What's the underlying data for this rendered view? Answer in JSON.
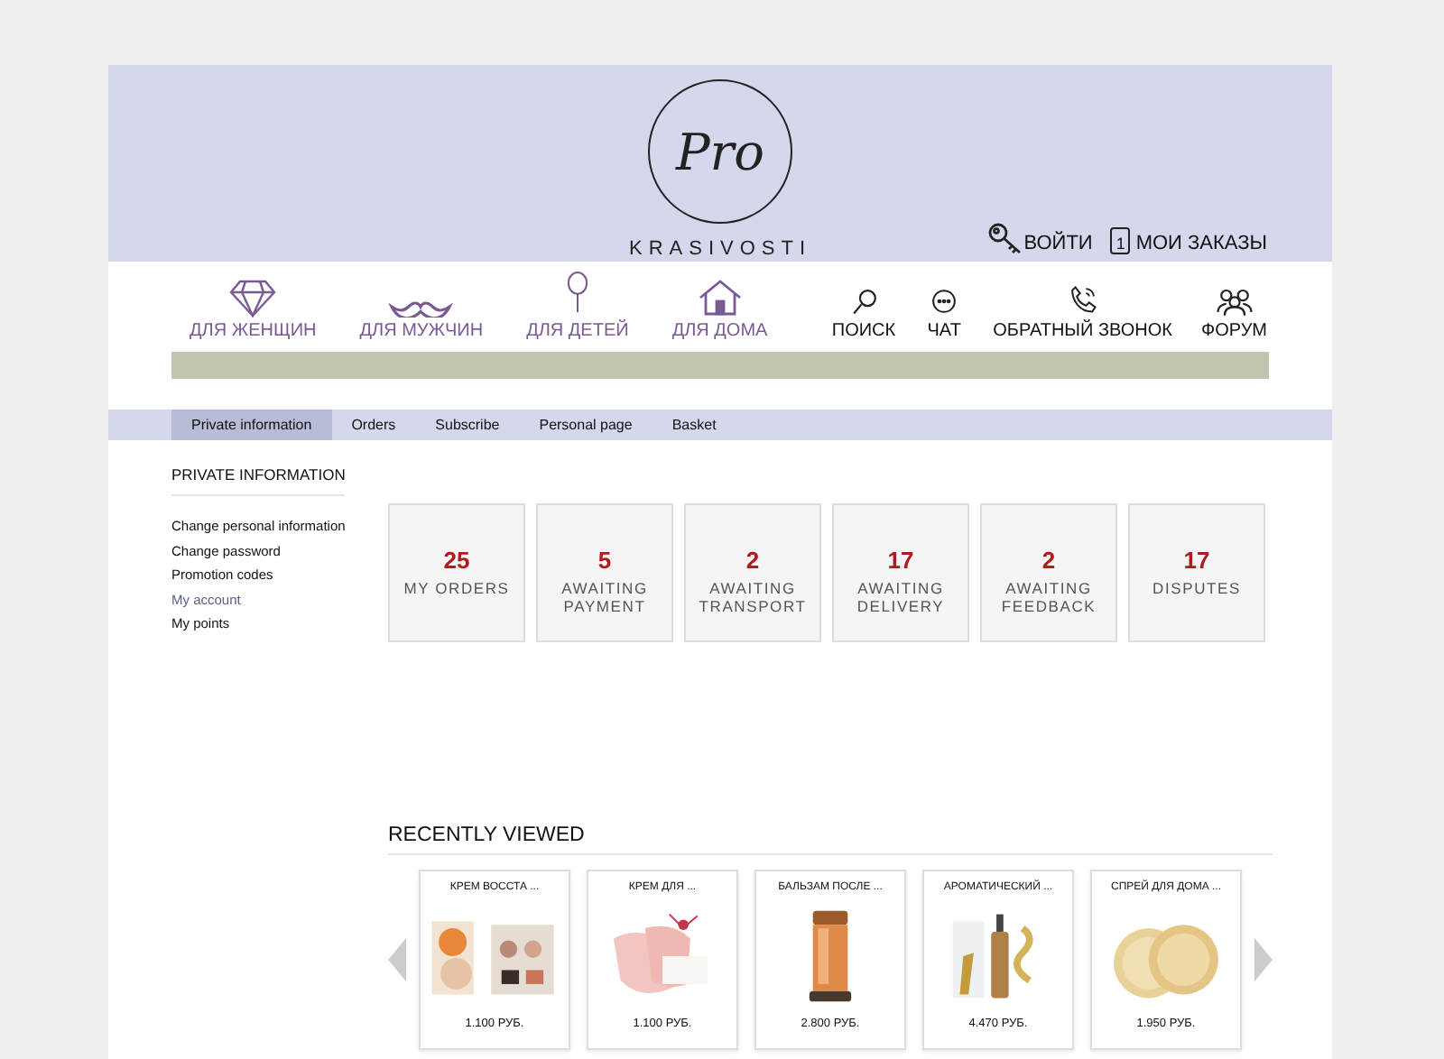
{
  "logo": {
    "mark": "Pro",
    "name": "KRASIVOSTI"
  },
  "account_links": [
    {
      "label": "ВОЙТИ"
    },
    {
      "label": "МОИ ЗАКАЗЫ",
      "badge": "1"
    }
  ],
  "categories": [
    {
      "label": "ДЛЯ ЖЕНЩИН"
    },
    {
      "label": "ДЛЯ МУЖЧИН"
    },
    {
      "label": "ДЛЯ ДЕТЕЙ"
    },
    {
      "label": "ДЛЯ ДОМА"
    }
  ],
  "tools": [
    {
      "label": "ПОИСК"
    },
    {
      "label": "ЧАТ"
    },
    {
      "label": "ОБРАТНЫЙ ЗВОНОК"
    },
    {
      "label": "ФОРУМ"
    }
  ],
  "tabs": [
    {
      "label": "Private information",
      "selected": true
    },
    {
      "label": "Orders",
      "selected": false
    },
    {
      "label": "Subscribe",
      "selected": false
    },
    {
      "label": "Personal page",
      "selected": false
    },
    {
      "label": "Basket",
      "selected": false
    }
  ],
  "sidebar": {
    "title": "PRIVATE INFORMATION",
    "items": [
      {
        "label": "Change personal information",
        "selected": false
      },
      {
        "label": "Change password",
        "selected": false
      },
      {
        "label": "Promotion codes",
        "selected": false
      },
      {
        "label": "My account",
        "selected": true
      },
      {
        "label": "My points",
        "selected": false
      }
    ]
  },
  "stats": [
    {
      "value": "25",
      "label": "MY ORDERS"
    },
    {
      "value": "5",
      "label": "AWAITING PAYMENT"
    },
    {
      "value": "2",
      "label": "AWAITING TRANSPORT"
    },
    {
      "value": "17",
      "label": "AWAITING DELIVERY"
    },
    {
      "value": "2",
      "label": "AWAITING FEEDBACK"
    },
    {
      "value": "17",
      "label": "DISPUTES"
    }
  ],
  "recently_viewed": {
    "title": "RECENTLY VIEWED",
    "products": [
      {
        "name": "КРЕМ ВОССТА ...",
        "price": "1.100 РУБ.",
        "kind": "picture"
      },
      {
        "name": "КРЕМ ДЛЯ ...",
        "price": "1.100 РУБ.",
        "kind": "picture"
      },
      {
        "name": "БАЛЬЗАМ ПОСЛЕ ...",
        "price": "2.800 РУБ.",
        "kind": "picture"
      },
      {
        "name": "АРОМАТИЧЕСКИЙ ...",
        "price": "4.470 РУБ.",
        "kind": "picture"
      },
      {
        "name": "СПРЕЙ ДЛЯ ДОМА ...",
        "price": "1.950 РУБ.",
        "kind": "picture"
      }
    ]
  }
}
